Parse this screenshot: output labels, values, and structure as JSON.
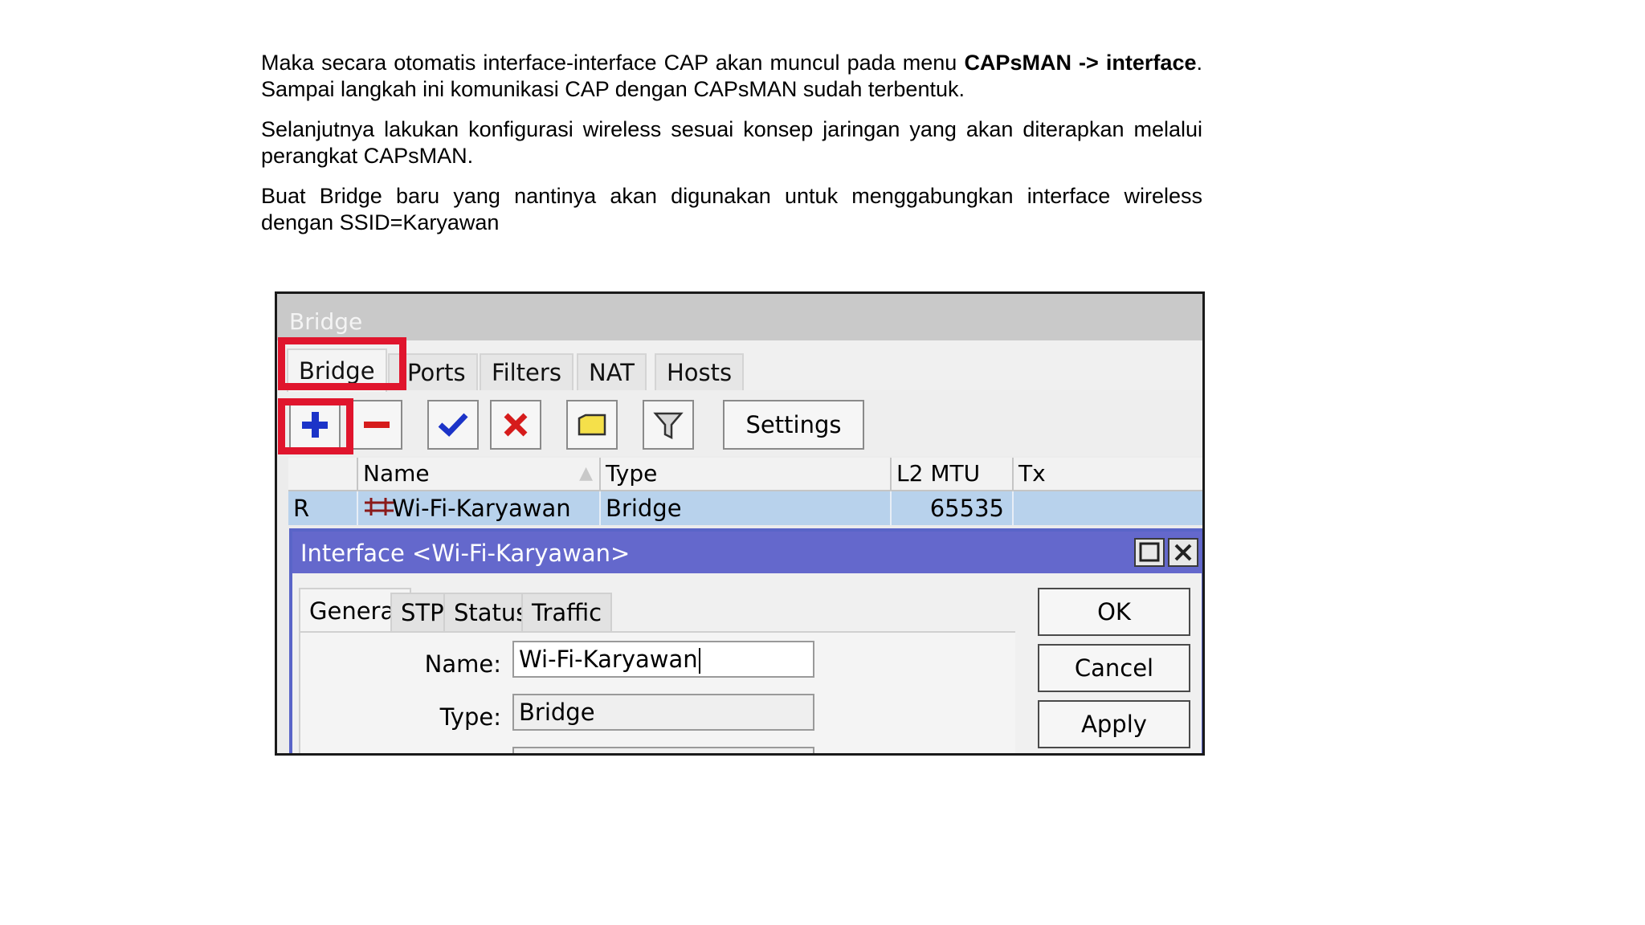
{
  "document": {
    "para1_text": "Maka secara otomatis interface-interface CAP akan muncul pada menu ",
    "para1_bold": "CAPsMAN -> interface",
    "para1_rest": ". Sampai langkah ini komunikasi CAP dengan CAPsMAN sudah terbentuk.",
    "para2": "Selanjutnya lakukan konfigurasi wireless sesuai konsep jaringan yang akan diterapkan melalui perangkat CAPsMAN.",
    "para3": "Buat Bridge baru yang nantinya akan digunakan untuk menggabungkan interface wireless dengan SSID=Karyawan"
  },
  "window": {
    "title": "Bridge",
    "tabs": [
      "Bridge",
      "Ports",
      "Filters",
      "NAT",
      "Hosts"
    ],
    "active_tab": "Bridge",
    "toolbar": {
      "icons": [
        "add-icon",
        "remove-icon",
        "enable-check-icon",
        "disable-x-icon",
        "comment-icon",
        "filter-icon"
      ],
      "settings_label": "Settings"
    },
    "grid": {
      "columns": [
        "",
        "Name",
        "Type",
        "L2 MTU",
        "Tx"
      ],
      "rows": [
        {
          "flag": "R",
          "name": "Wi-Fi-Karyawan",
          "type": "Bridge",
          "l2mtu": "65535",
          "tx": ""
        }
      ]
    }
  },
  "dialog": {
    "title": "Interface <Wi-Fi-Karyawan>",
    "tabs": [
      "General",
      "STP",
      "Status",
      "Traffic"
    ],
    "active_tab": "General",
    "name_label": "Name:",
    "name_value": "Wi-Fi-Karyawan",
    "type_label": "Type:",
    "type_value": "Bridge",
    "buttons": {
      "ok": "OK",
      "cancel": "Cancel",
      "apply": "Apply"
    }
  },
  "colors": {
    "highlight": "#e0152d",
    "dialog_title": "#6468cc",
    "selected_row": "#b8d2ec"
  }
}
